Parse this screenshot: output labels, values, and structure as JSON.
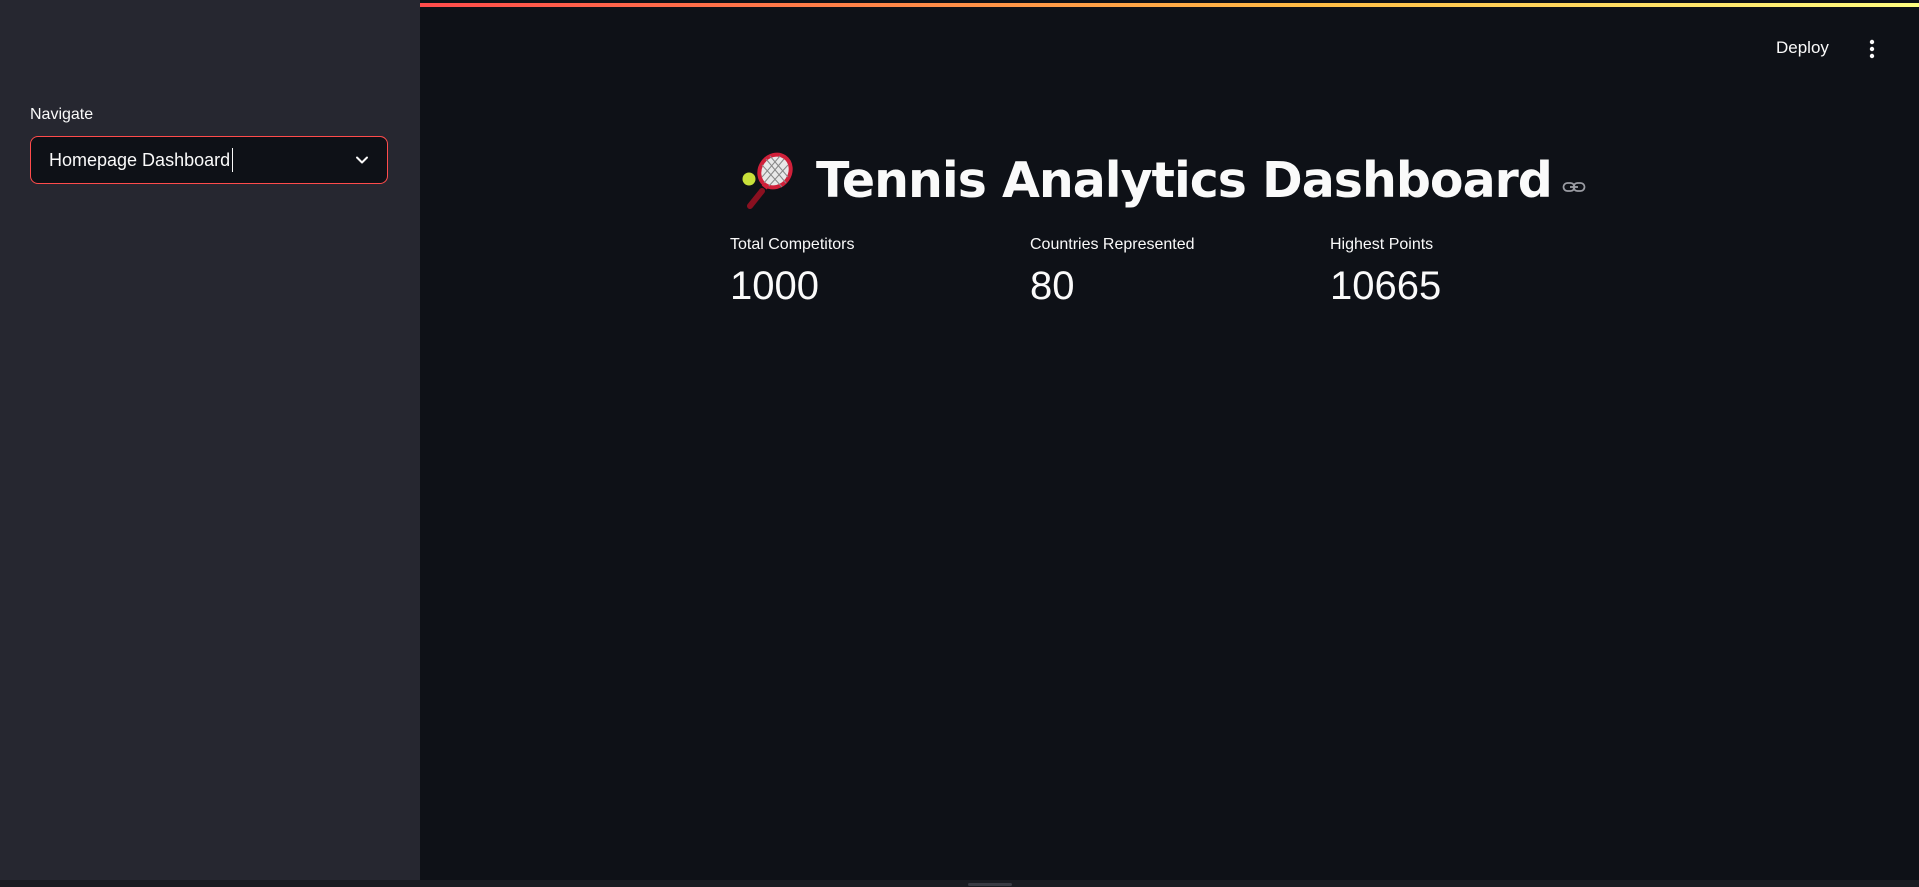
{
  "sidebar": {
    "nav_label": "Navigate",
    "select_value": "Homepage Dashboard"
  },
  "header": {
    "deploy_label": "Deploy",
    "menu_icon": "more-vert-icon"
  },
  "main": {
    "title": "Tennis Analytics Dashboard",
    "title_icon": "tennis-racket-icon",
    "metrics": [
      {
        "label": "Total Competitors",
        "value": "1000"
      },
      {
        "label": "Countries Represented",
        "value": "80"
      },
      {
        "label": "Highest Points",
        "value": "10665"
      }
    ]
  },
  "colors": {
    "accent": "#ff4b4b",
    "background": "#0e1117",
    "sidebar": "#262730",
    "text": "#fafafa"
  }
}
